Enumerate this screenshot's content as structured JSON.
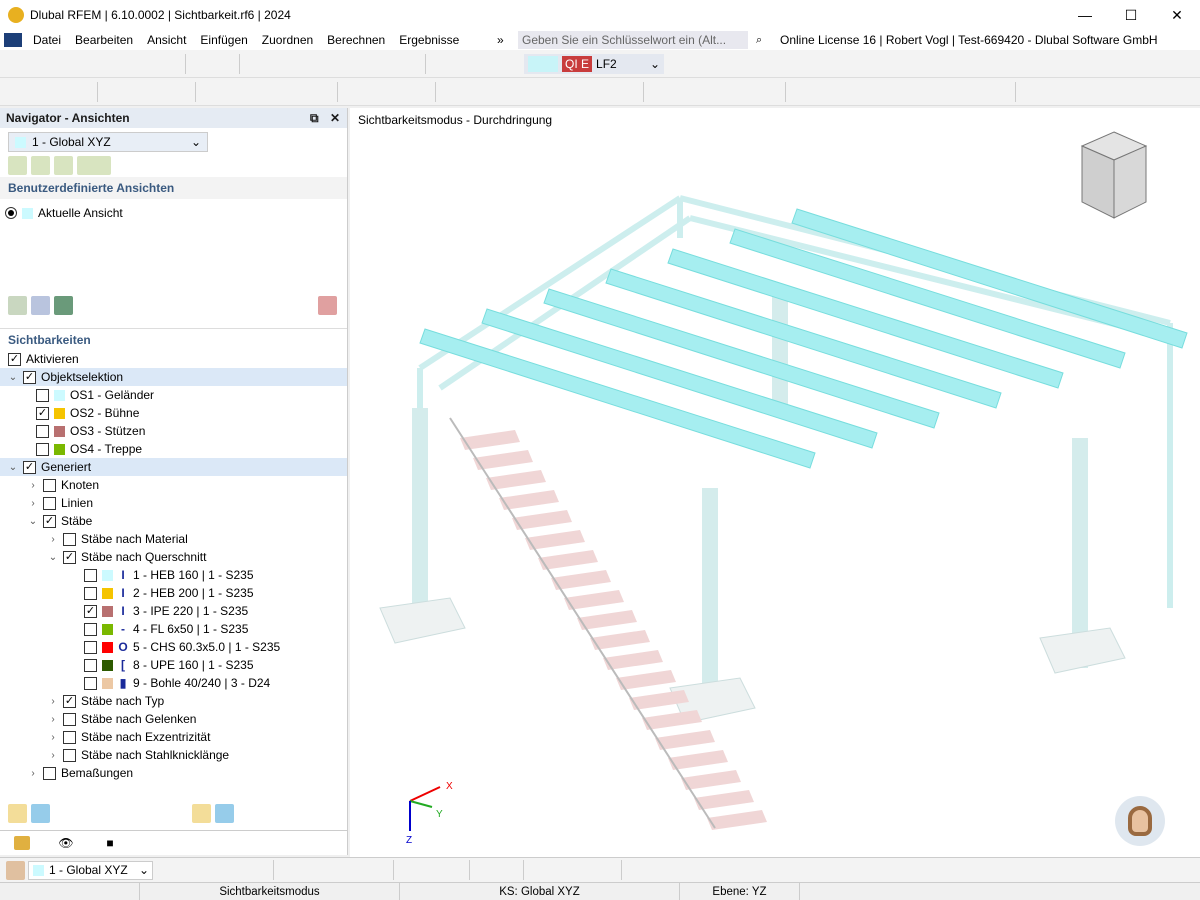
{
  "window": {
    "title": "Dlubal RFEM | 6.10.0002 | Sichtbarkeit.rf6 | 2024",
    "minimize": "—",
    "maximize": "☐",
    "close": "✕"
  },
  "menu": {
    "items": [
      "Datei",
      "Bearbeiten",
      "Ansicht",
      "Einfügen",
      "Zuordnen",
      "Berechnen",
      "Ergebnisse"
    ],
    "overflow": "»",
    "search_placeholder": "Geben Sie ein Schlüsselwort ein (Alt...",
    "license": "Online License 16 | Robert Vogl | Test-669420 - Dlubal Software GmbH"
  },
  "toolbar": {
    "load_case_type": "QI E",
    "load_case": "LF2"
  },
  "navigator": {
    "title": "Navigator - Ansichten",
    "view_select": "1 - Global XYZ",
    "custom_views_heading": "Benutzerdefinierte Ansichten",
    "current_view": "Aktuelle Ansicht",
    "visibilities_heading": "Sichtbarkeiten",
    "activate": "Aktivieren",
    "object_selection": "Objektselektion",
    "os_items": [
      {
        "label": "OS1 - Geländer",
        "color": "#ccfaff",
        "checked": false
      },
      {
        "label": "OS2 - Bühne",
        "color": "#f5c400",
        "checked": true
      },
      {
        "label": "OS3 - Stützen",
        "color": "#b87070",
        "checked": false
      },
      {
        "label": "OS4 - Treppe",
        "color": "#7ab800",
        "checked": false
      }
    ],
    "generated": "Generiert",
    "gen_items": [
      {
        "label": "Knoten",
        "checked": false
      },
      {
        "label": "Linien",
        "checked": false
      },
      {
        "label": "Stäbe",
        "checked": true
      }
    ],
    "staebe_items": [
      {
        "label": "Stäbe nach Material",
        "checked": false
      },
      {
        "label": "Stäbe nach Querschnitt",
        "checked": true
      }
    ],
    "sections": [
      {
        "label": "1 - HEB 160 | 1 - S235",
        "color": "#ccfaff",
        "icon": "I",
        "checked": false
      },
      {
        "label": "2 - HEB 200 | 1 - S235",
        "color": "#f5c400",
        "icon": "I",
        "checked": false
      },
      {
        "label": "3 - IPE 220 | 1 - S235",
        "color": "#b87070",
        "icon": "I",
        "checked": true
      },
      {
        "label": "4 - FL 6x50 | 1 - S235",
        "color": "#7ab800",
        "icon": "-",
        "checked": false
      },
      {
        "label": "5 - CHS 60.3x5.0 | 1 - S235",
        "color": "#ff0000",
        "icon": "O",
        "checked": false
      },
      {
        "label": "8 - UPE 160 | 1 - S235",
        "color": "#2d5a00",
        "icon": "[",
        "checked": false
      },
      {
        "label": "9 - Bohle 40/240 | 3 - D24",
        "color": "#ecc8a4",
        "icon": "▮",
        "checked": false
      }
    ],
    "more_staebe": [
      {
        "label": "Stäbe nach Typ",
        "checked": true
      },
      {
        "label": "Stäbe nach Gelenken",
        "checked": false
      },
      {
        "label": "Stäbe nach Exzentrizität",
        "checked": false
      },
      {
        "label": "Stäbe nach Stahlknicklänge",
        "checked": false
      }
    ],
    "dimensions": "Bemaßungen"
  },
  "viewport": {
    "title": "Sichtbarkeitsmodus - Durchdringung",
    "axes": {
      "x": "X",
      "y": "Y",
      "z": "Z"
    }
  },
  "bottom": {
    "view_select": "1 - Global XYZ"
  },
  "status": {
    "mode": "Sichtbarkeitsmodus",
    "cs": "KS: Global XYZ",
    "plane": "Ebene: YZ"
  },
  "colors": {
    "beam": "#a6eef0",
    "frame": "#cdeeee",
    "stair": "#f0d6d6",
    "accent": "#3a5a80"
  }
}
